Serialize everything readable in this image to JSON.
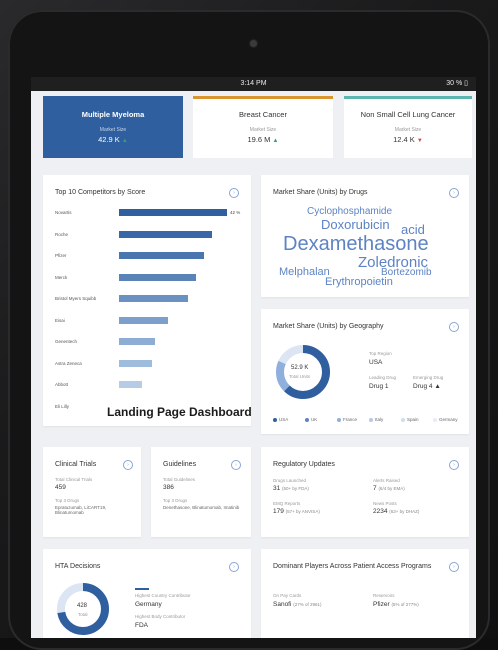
{
  "status": {
    "time": "3:14 PM",
    "battery": "30 % ▯"
  },
  "tabs": [
    {
      "name": "Multiple Myeloma",
      "sublabel": "Market Size",
      "value": "42.9 K",
      "trend": "▲"
    },
    {
      "name": "Breast Cancer",
      "sublabel": "Market Size",
      "value": "19.6 M",
      "trend": "▲",
      "accent": "#d9962e"
    },
    {
      "name": "Non Small Cell Lung Cancer",
      "sublabel": "Market Size",
      "value": "12.4 K",
      "trend": "▼",
      "accent": "#5fb6b0"
    }
  ],
  "competitors": {
    "title": "Top 10 Competitors by Score",
    "items": [
      {
        "label": "Novartis",
        "value": 42,
        "value_label": "42 %"
      },
      {
        "label": "Roche",
        "value": 36
      },
      {
        "label": "Pfizer",
        "value": 33
      },
      {
        "label": "Merck",
        "value": 30
      },
      {
        "label": "Bristol Myers Squibb",
        "value": 27
      },
      {
        "label": "Eisai",
        "value": 19
      },
      {
        "label": "Genentech",
        "value": 14
      },
      {
        "label": "Astra Zeneca",
        "value": 13
      },
      {
        "label": "Abbott",
        "value": 9
      },
      {
        "label": "Eli Lilly",
        "value": 0
      }
    ],
    "caption": "Landing Page Dashboard"
  },
  "drugs": {
    "title": "Market Share (Units) by Drugs",
    "words": [
      "Cyclophosphamide",
      "Doxorubicin",
      "acid",
      "Dexamethasone",
      "Zoledronic",
      "Melphalan",
      "Bortezomib",
      "Erythropoietin"
    ]
  },
  "geography": {
    "title": "Market Share (Units) by Geography",
    "donut_value": "52.9 K",
    "donut_label": "Total Units",
    "top_region_label": "Top Region",
    "top_region": "USA",
    "leading_label": "Leading Drug",
    "leading_value": "Drug 1",
    "emerging_label": "Emerging Drug",
    "emerging_value": "Drug 4 ▲",
    "legend": [
      {
        "name": "USA",
        "color": "#2f5f9e"
      },
      {
        "name": "UK",
        "color": "#5d83c4"
      },
      {
        "name": "France",
        "color": "#8fb0dd"
      },
      {
        "name": "Italy",
        "color": "#b5c9e8"
      },
      {
        "name": "Spain",
        "color": "#d0dcef"
      },
      {
        "name": "Germany",
        "color": "#e6ecf6"
      }
    ]
  },
  "trials": {
    "title": "Clinical Trials",
    "total_label": "Total Clinical Trials",
    "total": "459",
    "top_label": "Top 3 Drugs",
    "top": "Epratuzumab, LiCART19, Blinatumomab"
  },
  "guidelines": {
    "title": "Guidelines",
    "total_label": "Total Guidelines",
    "total": "386",
    "top_label": "Top 3 Drugs",
    "top": "Denethasone, Blinatumomab, Imatinib"
  },
  "regulatory": {
    "title": "Regulatory Updates",
    "items": [
      {
        "label": "Drugs Launched",
        "value": "31",
        "note": "(50+ by FDA)"
      },
      {
        "label": "Alerts Raised",
        "value": "7",
        "note": "(6/4 by EMA)"
      },
      {
        "label": "EMQ Reports",
        "value": "179",
        "note": "(57+ by ANVISA)"
      },
      {
        "label": "News Posts",
        "value": "2234",
        "note": "(63+ by DHAZ)"
      }
    ]
  },
  "hta": {
    "title": "HTA Decisions",
    "donut_value": "428",
    "donut_label": "Total",
    "country_label": "Highest Country Contributor",
    "country": "Germany",
    "body_label": "Highest Body Contributor",
    "body": "FDA"
  },
  "players": {
    "title": "Dominant Players Across Patient Access Programs",
    "col1_label": "On Pay Cards",
    "col1_value": "Sanofi",
    "col1_note": "(27% of 2961)",
    "col2_label": "Reservoirs",
    "col2_value": "Pfizer",
    "col2_note": "(5% of 277%)"
  }
}
